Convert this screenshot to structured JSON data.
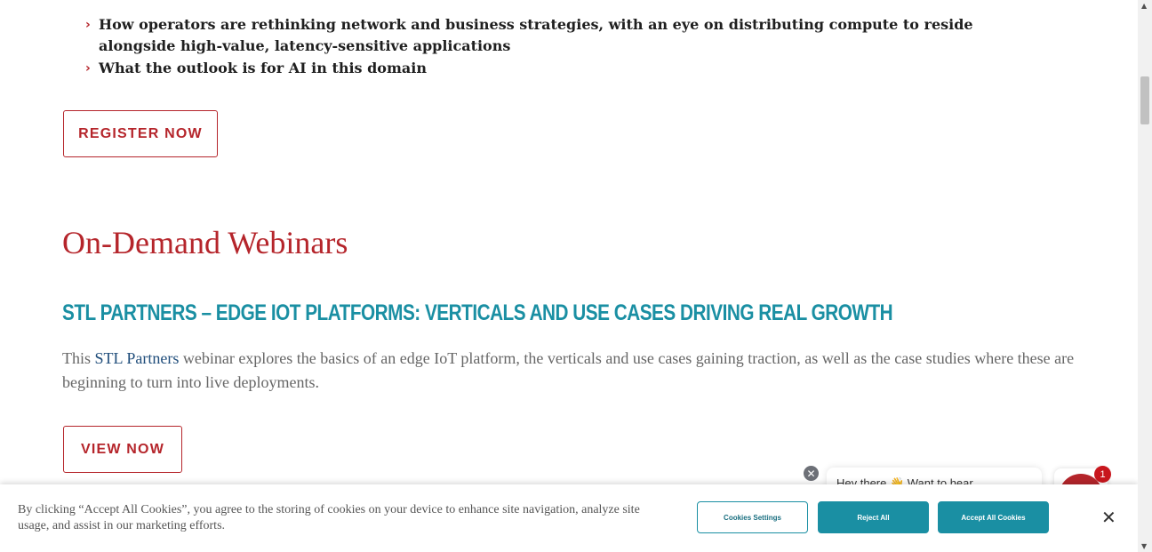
{
  "bullets": [
    "How operators are rethinking network and business strategies, with an eye on distributing compute to reside alongside high-value, latency-sensitive applications",
    "What the outlook is for AI in this domain"
  ],
  "register_button": "REGISTER NOW",
  "section_title": "On-Demand Webinars",
  "webinar": {
    "title": "STL PARTNERS – EDGE IOT PLATFORMS: VERTICALS AND USE CASES DRIVING REAL GROWTH",
    "desc_prefix": "This ",
    "desc_link": "STL Partners",
    "desc_suffix": " webinar explores the basics of an edge IoT platform, the verticals and use cases gaining traction, as well as the case studies where these are beginning to turn into live deployments.",
    "button": "VIEW NOW"
  },
  "chat": {
    "message": "Hey there 👋 Want to hear",
    "close_glyph": "✕",
    "badge_count": "1"
  },
  "cookie": {
    "text": "By clicking “Accept All Cookies”, you agree to the storing of cookies on your device to enhance site navigation, analyze site usage, and assist in our marketing efforts.",
    "settings": "Cookies Settings",
    "reject": "Reject All",
    "accept": "Accept All Cookies",
    "close_glyph": "✕"
  },
  "icons": {
    "chevron": "›",
    "scroll_up": "▲",
    "scroll_down": "▼"
  },
  "colors": {
    "brand_red": "#b5252b",
    "teal": "#1a8fa3",
    "link_blue": "#1e4c7a"
  }
}
